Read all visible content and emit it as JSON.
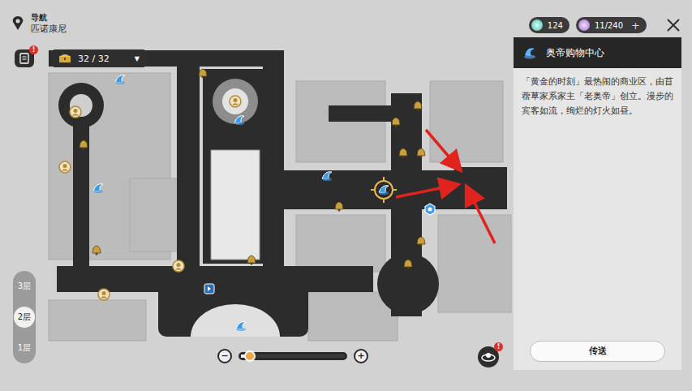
{
  "header": {
    "label": "导航",
    "location": "匹诺康尼"
  },
  "currencies": [
    {
      "value": "124",
      "add": ""
    },
    {
      "value": "11/240",
      "add": "+"
    }
  ],
  "journal_badge": "!",
  "chests": {
    "count": "32 / 32",
    "dropdown": "▼"
  },
  "floors": [
    {
      "label": "3层",
      "selected": false
    },
    {
      "label": "2层",
      "selected": true
    },
    {
      "label": "1层",
      "selected": false
    }
  ],
  "zoom": {
    "minus": "−",
    "plus": "+",
    "level": 0.07
  },
  "map": {
    "markers": [
      {
        "kind": "teleport",
        "selected": false
      },
      {
        "kind": "teleport",
        "selected": false
      },
      {
        "kind": "teleport",
        "selected": false
      },
      {
        "kind": "teleport",
        "selected": false
      },
      {
        "kind": "teleport",
        "selected": true
      },
      {
        "kind": "teleport",
        "selected": false
      },
      {
        "kind": "anchor",
        "selected": false
      },
      {
        "kind": "bell",
        "selected": false
      },
      {
        "kind": "bell",
        "selected": false
      },
      {
        "kind": "bell",
        "selected": false
      },
      {
        "kind": "bell",
        "selected": false
      },
      {
        "kind": "bell",
        "selected": false
      },
      {
        "kind": "bell",
        "selected": false
      },
      {
        "kind": "bell",
        "selected": false
      },
      {
        "kind": "bell",
        "selected": false
      },
      {
        "kind": "bell",
        "selected": false
      },
      {
        "kind": "bell",
        "selected": false
      },
      {
        "kind": "bell",
        "selected": false
      },
      {
        "kind": "npc",
        "selected": false
      },
      {
        "kind": "npc",
        "selected": false
      },
      {
        "kind": "npc",
        "selected": false
      },
      {
        "kind": "npc",
        "selected": false
      },
      {
        "kind": "npc",
        "selected": false
      },
      {
        "kind": "exit",
        "selected": false
      }
    ]
  },
  "panel": {
    "title": "奥帝购物中心",
    "description": "「黄金的时刻」最热闹的商业区，由苜蓿草家系家主「老奥帝」创立。漫步的宾客如流，绚烂的灯火如昼。",
    "button": "传送"
  },
  "corner_badge": "!"
}
